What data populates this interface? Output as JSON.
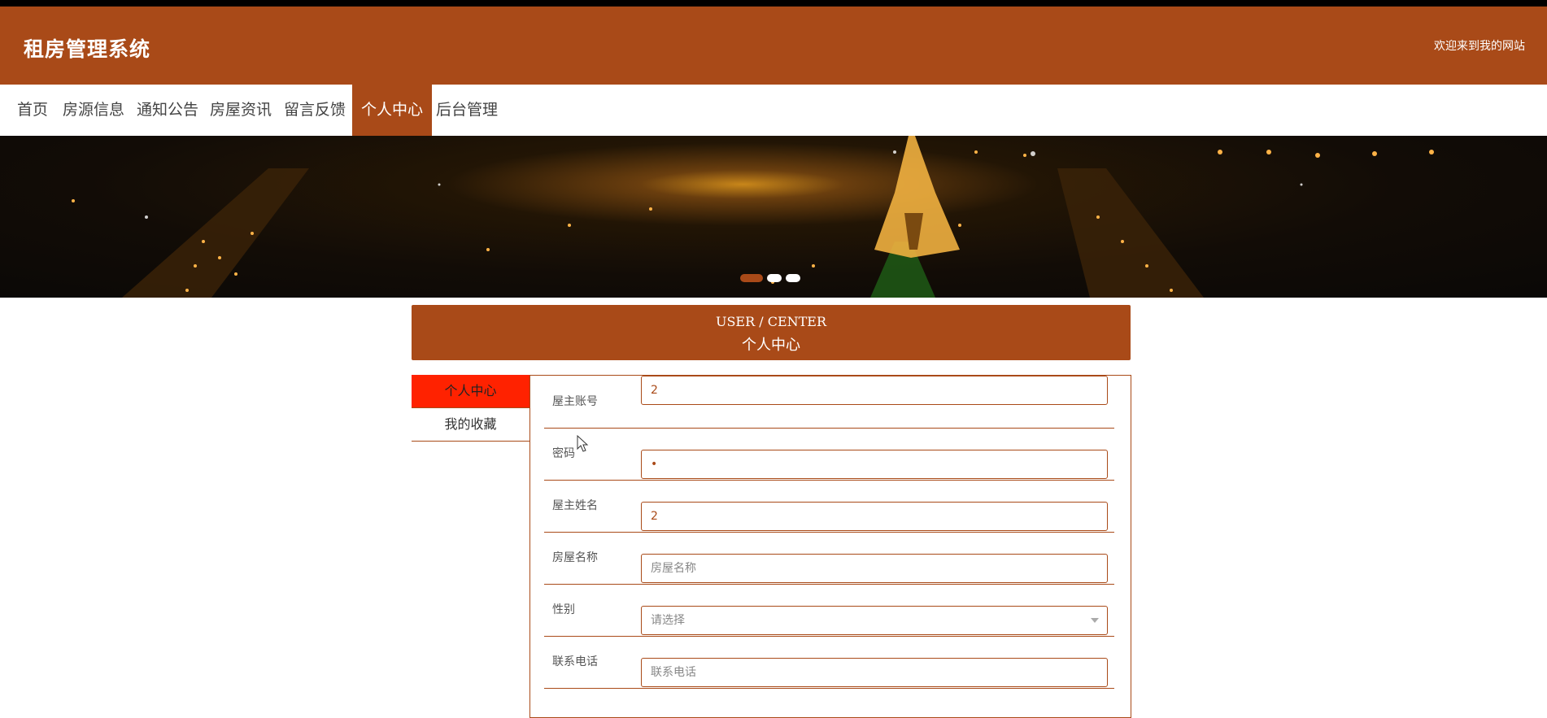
{
  "header": {
    "title": "租房管理系统",
    "welcome": "欢迎来到我的网站"
  },
  "nav": {
    "items": [
      {
        "label": "首页"
      },
      {
        "label": "房源信息"
      },
      {
        "label": "通知公告"
      },
      {
        "label": "房屋资讯"
      },
      {
        "label": "留言反馈"
      },
      {
        "label": "个人中心",
        "active": true
      },
      {
        "label": "后台管理"
      }
    ]
  },
  "banner": {
    "slides": 3,
    "active_slide": 1
  },
  "section": {
    "title_en": "USER / CENTER",
    "title_cn": "个人中心"
  },
  "sidebar": {
    "items": [
      {
        "label": "个人中心",
        "active": true
      },
      {
        "label": "我的收藏"
      }
    ]
  },
  "form": {
    "fields": [
      {
        "label": "屋主账号",
        "value": "2",
        "placeholder": "屋主账号"
      },
      {
        "label": "密码",
        "value": "•",
        "placeholder": "密码"
      },
      {
        "label": "屋主姓名",
        "value": "2",
        "placeholder": "屋主姓名"
      },
      {
        "label": "房屋名称",
        "value": "",
        "placeholder": "房屋名称"
      },
      {
        "label": "性别",
        "value": "",
        "placeholder": "请选择"
      },
      {
        "label": "联系电话",
        "value": "",
        "placeholder": "联系电话"
      }
    ]
  },
  "colors": {
    "brand": "#a94a18",
    "active_sidebar": "#ff2200"
  }
}
